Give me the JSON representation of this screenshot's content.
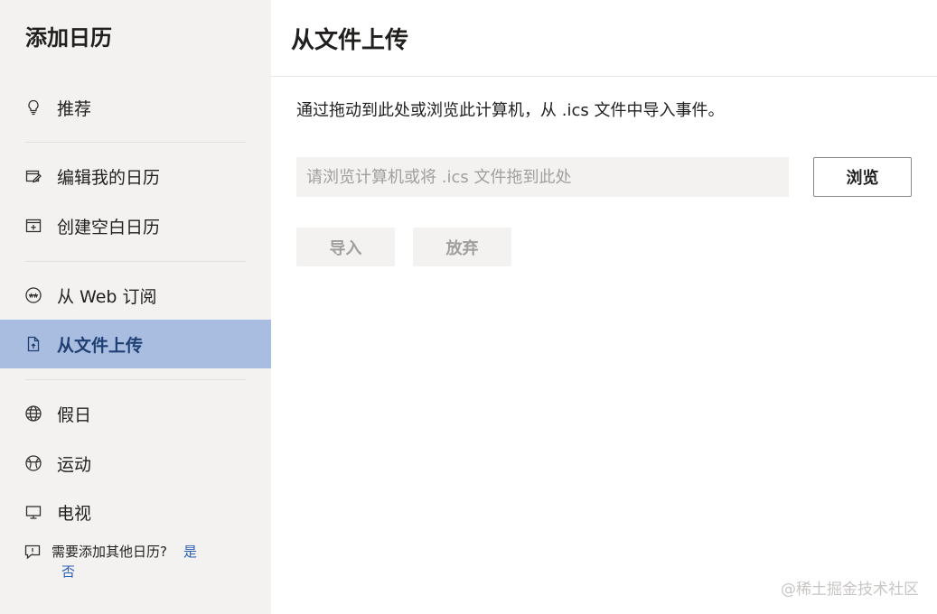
{
  "sidebar": {
    "title": "添加日历",
    "items": [
      {
        "label": "推荐",
        "icon": "lightbulb-icon"
      },
      {
        "label": "编辑我的日历",
        "icon": "edit-calendar-icon"
      },
      {
        "label": "创建空白日历",
        "icon": "calendar-add-icon"
      },
      {
        "label": "从 Web 订阅",
        "icon": "web-subscribe-icon"
      },
      {
        "label": "从文件上传",
        "icon": "file-upload-icon",
        "selected": true
      },
      {
        "label": "假日",
        "icon": "globe-icon"
      },
      {
        "label": "运动",
        "icon": "sports-ball-icon"
      },
      {
        "label": "电视",
        "icon": "tv-icon"
      }
    ],
    "help": {
      "question": "需要添加其他日历?",
      "yes": "是",
      "no": "否"
    }
  },
  "main": {
    "title": "从文件上传",
    "description": "通过拖动到此处或浏览此计算机，从 .ics 文件中导入事件。",
    "file_input_placeholder": "请浏览计算机或将 .ics 文件拖到此处",
    "browse_label": "浏览",
    "import_label": "导入",
    "discard_label": "放弃"
  },
  "watermark": "@稀土掘金技术社区",
  "colors": {
    "sidebar_bg": "#f3f2f1",
    "selected_bg": "#a8bddf",
    "selected_text": "#1f3f73",
    "link": "#2b5fb4"
  }
}
